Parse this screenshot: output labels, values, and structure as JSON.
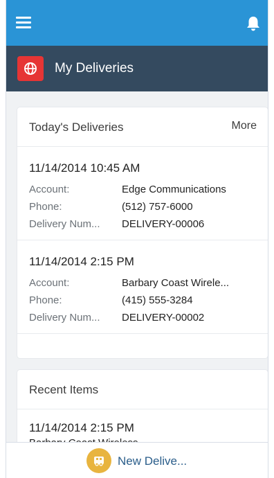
{
  "topbar": {
    "menu_icon": "hamburger-menu-icon",
    "notification_icon": "bell-icon"
  },
  "header": {
    "title": "My Deliveries",
    "app_icon": "globe-icon",
    "app_icon_color": "#e63535"
  },
  "todays_card": {
    "title": "Today's Deliveries",
    "more_label": "More",
    "records": [
      {
        "title": "11/14/2014 10:45 AM",
        "fields": [
          {
            "label": "Account:",
            "value": "Edge Communications"
          },
          {
            "label": "Phone:",
            "value": "(512) 757-6000"
          },
          {
            "label": "Delivery Num...",
            "value": "DELIVERY-00006"
          }
        ]
      },
      {
        "title": "11/14/2014 2:15 PM",
        "fields": [
          {
            "label": "Account:",
            "value": "Barbary Coast Wirele..."
          },
          {
            "label": "Phone:",
            "value": "(415) 555-3284"
          },
          {
            "label": "Delivery Num...",
            "value": "DELIVERY-00002"
          }
        ]
      }
    ]
  },
  "recent_card": {
    "title": "Recent Items",
    "items": [
      {
        "date": "11/14/2014 2:15 PM",
        "subtitle": "Barbary Coast Wireless"
      }
    ]
  },
  "bottombar": {
    "action_label": "New Delive...",
    "action_icon": "delivery-icon",
    "action_color": "#e8b43f"
  },
  "colors": {
    "topbar": "#2a94d6",
    "header": "#344a5f",
    "link": "#2a5d8a"
  }
}
